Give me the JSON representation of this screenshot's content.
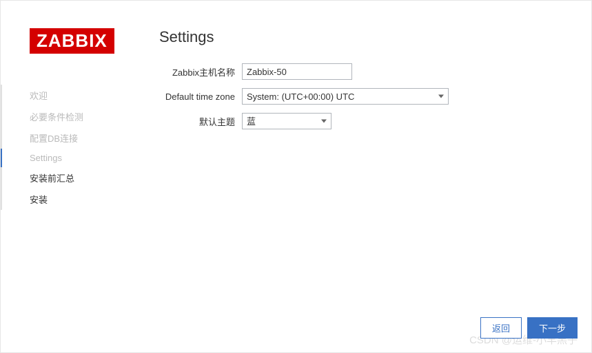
{
  "logo": "ZABBIX",
  "sidebar": {
    "items": [
      {
        "label": "欢迎",
        "state": "done"
      },
      {
        "label": "必要条件检测",
        "state": "done"
      },
      {
        "label": "配置DB连接",
        "state": "done"
      },
      {
        "label": "Settings",
        "state": "current"
      },
      {
        "label": "安装前汇总",
        "state": "pending"
      },
      {
        "label": "安装",
        "state": "pending"
      }
    ]
  },
  "page": {
    "title": "Settings"
  },
  "form": {
    "hostname": {
      "label": "Zabbix主机名称",
      "value": "Zabbix-50"
    },
    "timezone": {
      "label": "Default time zone",
      "value": "System: (UTC+00:00) UTC"
    },
    "theme": {
      "label": "默认主题",
      "value": "蓝"
    }
  },
  "buttons": {
    "back": "返回",
    "next": "下一步"
  },
  "watermark": "CSDN @运维-小羊羔子"
}
